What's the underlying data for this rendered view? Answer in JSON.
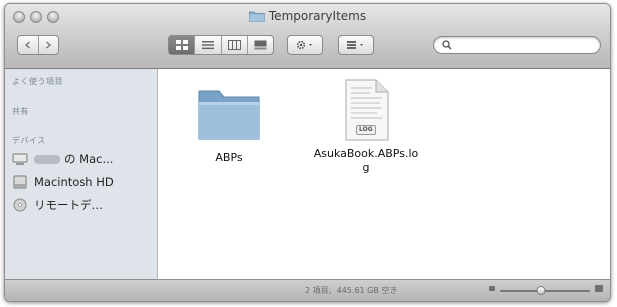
{
  "window": {
    "title": "TemporaryItems"
  },
  "toolbar": {
    "back_icon": "chevron-left-icon",
    "forward_icon": "chevron-right-icon",
    "views": [
      "icon-view-icon",
      "list-view-icon",
      "column-view-icon",
      "coverflow-view-icon"
    ],
    "active_view": "icon-view-icon",
    "action_icon": "gear-icon",
    "arrange_icon": "arrange-icon",
    "search": {
      "value": "",
      "placeholder": ""
    }
  },
  "sidebar": {
    "sections": [
      {
        "header": "よく使う項目"
      },
      {
        "header": "共有"
      },
      {
        "header": "デバイス"
      }
    ],
    "devices": [
      {
        "label": "の Mac...",
        "icon": "computer-icon"
      },
      {
        "label": "Macintosh HD",
        "icon": "hard-drive-icon"
      },
      {
        "label": "リモートデ…",
        "icon": "remote-disc-icon"
      }
    ]
  },
  "files": [
    {
      "name": "ABPs",
      "icon": "folder-icon"
    },
    {
      "name": "AsukaBook.ABPs.log",
      "icon": "log-file-icon",
      "badge": "LOG"
    }
  ],
  "status": {
    "text": "2 項目、445.61 GB 空き",
    "zoom_level": 0.45
  },
  "colors": {
    "folder": "#8fb4d3",
    "sidebar_bg": "#dfe4ea",
    "window_bg": "#ececec"
  }
}
